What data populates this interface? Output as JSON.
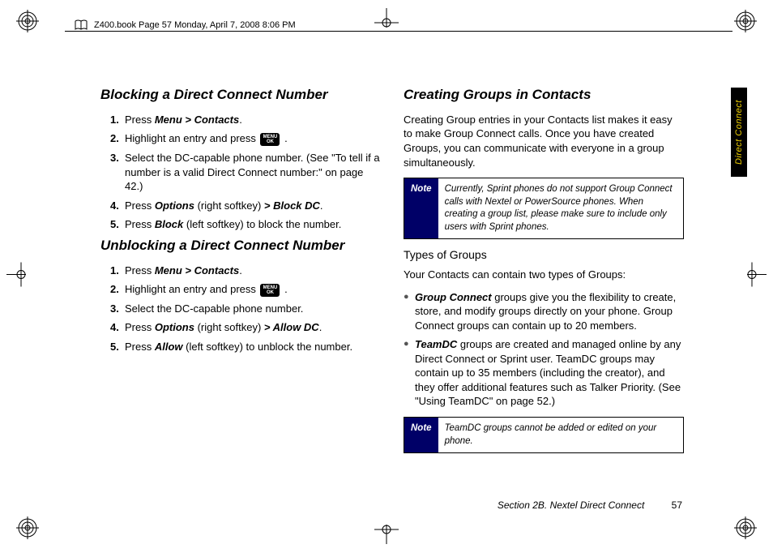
{
  "header": {
    "text": "Z400.book  Page 57  Monday, April 7, 2008  8:06 PM"
  },
  "sideTab": "Direct Connect",
  "footer": {
    "section": "Section 2B. Nextel Direct Connect",
    "page": "57"
  },
  "menuOk": {
    "line1": "MENU",
    "line2": "OK"
  },
  "left": {
    "h1_block": "Blocking a Direct Connect Number",
    "steps_block": {
      "1": {
        "a": "Press ",
        "b": "Menu > Contacts",
        "c": "."
      },
      "2": {
        "a": "Highlight an entry and press ",
        "c": " ."
      },
      "3": {
        "a": "Select the DC-capable phone number. (See \"To tell if a number is a valid Direct Connect number:\" on page 42.)"
      },
      "4": {
        "a": "Press ",
        "b": "Options",
        "c": " (right softkey) ",
        "d": "> Block DC",
        "e": "."
      },
      "5": {
        "a": "Press ",
        "b": "Block",
        "c": " (left softkey) to block the number."
      }
    },
    "h1_unblock": "Unblocking a Direct Connect Number",
    "steps_unblock": {
      "1": {
        "a": "Press ",
        "b": "Menu > Contacts",
        "c": "."
      },
      "2": {
        "a": "Highlight an entry and press ",
        "c": " ."
      },
      "3": {
        "a": "Select the DC-capable phone number."
      },
      "4": {
        "a": "Press ",
        "b": "Options",
        "c": " (right softkey) ",
        "d": "> Allow DC",
        "e": "."
      },
      "5": {
        "a": "Press ",
        "b": "Allow",
        "c": " (left softkey) to unblock the number."
      }
    }
  },
  "right": {
    "h1_groups": "Creating Groups in Contacts",
    "intro": "Creating Group entries in your Contacts list makes it easy to make Group Connect calls. Once you have created Groups, you can communicate with everyone in a group simultaneously.",
    "note1": {
      "label": "Note",
      "text": "Currently, Sprint phones do not support Group Connect calls with Nextel or PowerSource phones. When creating a group list, please make sure to include only users with Sprint phones."
    },
    "h2_types": "Types of Groups",
    "types_intro": "Your Contacts can contain two types of Groups:",
    "bullet1": {
      "b": "Group Connect",
      "rest": " groups give you the flexibility to create, store, and modify groups directly on your phone. Group Connect groups can contain up to 20 members."
    },
    "bullet2": {
      "b": "TeamDC",
      "rest": " groups are created and managed online by any Direct Connect or Sprint user. TeamDC groups may contain up to 35 members (including the creator), and they offer additional features such as Talker Priority. (See \"Using TeamDC\" on page 52.)"
    },
    "note2": {
      "label": "Note",
      "text": "TeamDC groups cannot be added or edited on your phone."
    }
  }
}
